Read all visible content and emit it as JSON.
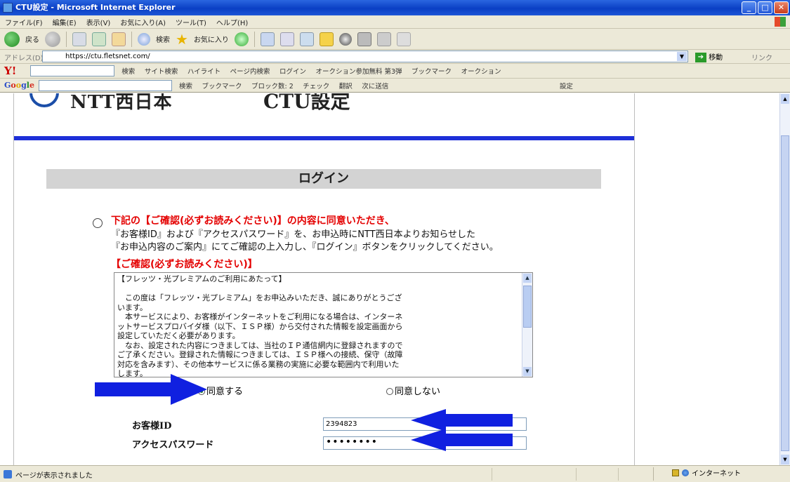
{
  "window": {
    "title": "CTU設定 - Microsoft Internet Explorer"
  },
  "menu": [
    "ファイル(F)",
    "編集(E)",
    "表示(V)",
    "お気に入り(A)",
    "ツール(T)",
    "ヘルプ(H)"
  ],
  "toolbar": {
    "back_label": "戻る",
    "search_label": "検索",
    "favorites_label": "お気に入り"
  },
  "address": {
    "label": "アドレス(D)",
    "url": "https://ctu.fletsnet.com/",
    "go_label": "移動",
    "links_label": "リンク"
  },
  "yahoo_bar": {
    "logo": "Y!",
    "items": [
      "検索",
      "サイト検索",
      "ハイライト",
      "ページ内検索",
      "ログイン",
      "オークション参加無料 第3弾",
      "ブックマーク",
      "オークション"
    ]
  },
  "google_bar": {
    "logo": [
      "G",
      "o",
      "o",
      "g",
      "l",
      "e"
    ],
    "items": [
      "検索",
      "ブックマーク",
      "ブロック数: 2",
      "チェック",
      "翻訳",
      "次に送信",
      "設定"
    ]
  },
  "page": {
    "logo_text": "NTT西日本",
    "heading": "CTU設定",
    "section_title": "ログイン",
    "notice_red": "下記の【ご確認(必ずお読みください)】の内容に同意いただき、",
    "notice_line1": "『お客様ID』および『アクセスパスワード』を、お申込時にNTT西日本よりお知らせした",
    "notice_line2": "『お申込内容のご案内』にてご確認の上入力し、『ログイン』ボタンをクリックしてください。",
    "confirm_label": "【ご確認(必ずお読みください)】",
    "terms_text": "【フレッツ・光プレミアムのご利用にあたって】\n\n　この度は「フレッツ・光プレミアム」をお申込みいただき、誠にありがとうござ\nいます。\n　本サービスにより、お客様がインターネットをご利用になる場合は、インターネ\nットサービスプロバイダ様（以下、ＩＳＰ様）から交付された情報を設定画面から\n設定していただく必要があります。\n　なお、設定された内容につきましては、当社のＩＰ通信網内に登録されますので\nご了承ください。登録された情報につきましては、ＩＳＰ様への接続、保守（故障\n対応を含みます）、その他本サービスに係る業務の実施に必要な範囲内で利用いた\nします。\n　ＩＳＰ様への接続において、当社のＩＰ通信網内に登録される情報は以下のとお",
    "agree_label": "同意する",
    "disagree_label": "同意しない",
    "agree_selected": true,
    "customer_id_label": "お客様ID",
    "customer_id_value": "2394823",
    "password_label": "アクセスパスワード",
    "password_value": "••••••••"
  },
  "status": {
    "text": "ページが表示されました",
    "zone": "インターネット"
  },
  "colors": {
    "arrow": "#1020e0",
    "notice_red": "#e40000",
    "blue_line": "#1d2fd8"
  }
}
